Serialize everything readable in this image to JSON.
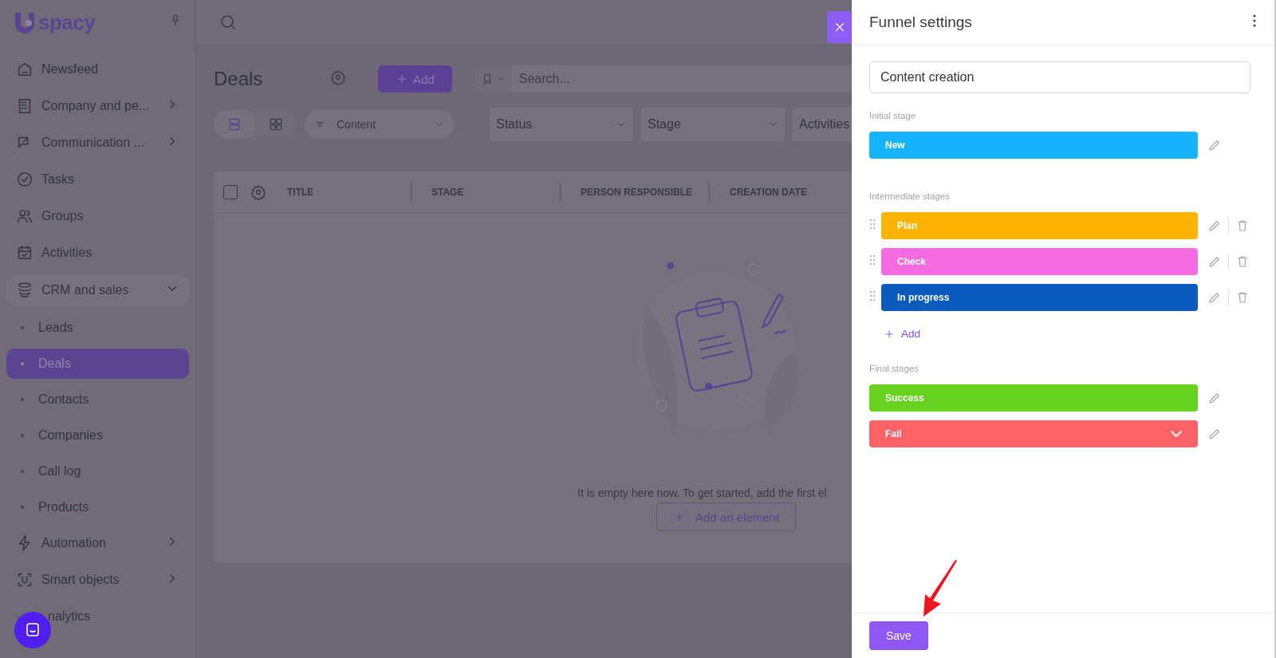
{
  "sidebar": {
    "logo": "spacy",
    "items": [
      {
        "label": "Newsfeed",
        "kind": "link"
      },
      {
        "label": "Company and pe...",
        "kind": "group",
        "expanded": false
      },
      {
        "label": "Communication ...",
        "kind": "group",
        "expanded": false
      },
      {
        "label": "Tasks",
        "kind": "link"
      },
      {
        "label": "Groups",
        "kind": "link"
      },
      {
        "label": "Activities",
        "kind": "link"
      },
      {
        "label": "CRM and sales",
        "kind": "group",
        "expanded": true,
        "children": [
          {
            "label": "Leads",
            "selected": false
          },
          {
            "label": "Deals",
            "selected": true
          },
          {
            "label": "Contacts",
            "selected": false
          },
          {
            "label": "Companies",
            "selected": false
          },
          {
            "label": "Call log",
            "selected": false
          },
          {
            "label": "Products",
            "selected": false
          }
        ]
      },
      {
        "label": "Automation",
        "kind": "group",
        "expanded": false
      },
      {
        "label": "Smart objects",
        "kind": "group",
        "expanded": false
      },
      {
        "label": "nalytics",
        "kind": "link"
      }
    ]
  },
  "main": {
    "title": "Deals",
    "add_button": "Add",
    "search": {
      "placeholder": "Search..."
    },
    "view_toggle": [
      {
        "selected": true
      },
      {
        "selected": false
      }
    ],
    "funnel_select": "Content",
    "filters": [
      "Status",
      "Stage",
      "Activities"
    ],
    "table": {
      "select_all": {
        "checked": false
      },
      "columns": [
        "TITLE",
        "STAGE",
        "PERSON RESPONSIBLE",
        "CREATION DATE"
      ]
    },
    "empty_state": {
      "message": "It is empty here now. To get started, add the first el",
      "button": "Add an element"
    }
  },
  "panel": {
    "title": "Funnel settings",
    "name_field": {
      "value": "Content creation"
    },
    "sections": [
      {
        "label": "Initial stage",
        "draggable": false,
        "removable": false,
        "stages": [
          {
            "name": "New",
            "color": "#16b4fe",
            "dropdown": false
          }
        ]
      },
      {
        "label": "Intermediate stages",
        "draggable": true,
        "removable": true,
        "stages": [
          {
            "name": "Plan",
            "color": "#feb300",
            "dropdown": false
          },
          {
            "name": "Check",
            "color": "#f66ae2",
            "dropdown": false
          },
          {
            "name": "In progress",
            "color": "#0a5bbd",
            "dropdown": false
          }
        ],
        "add_button": "Add"
      },
      {
        "label": "Final stages",
        "draggable": false,
        "removable": false,
        "stages": [
          {
            "name": "Success",
            "color": "#68d31f",
            "dropdown": false
          },
          {
            "name": "Fail",
            "color": "#fe6166",
            "dropdown": true
          }
        ]
      }
    ],
    "save_button": "Save"
  }
}
